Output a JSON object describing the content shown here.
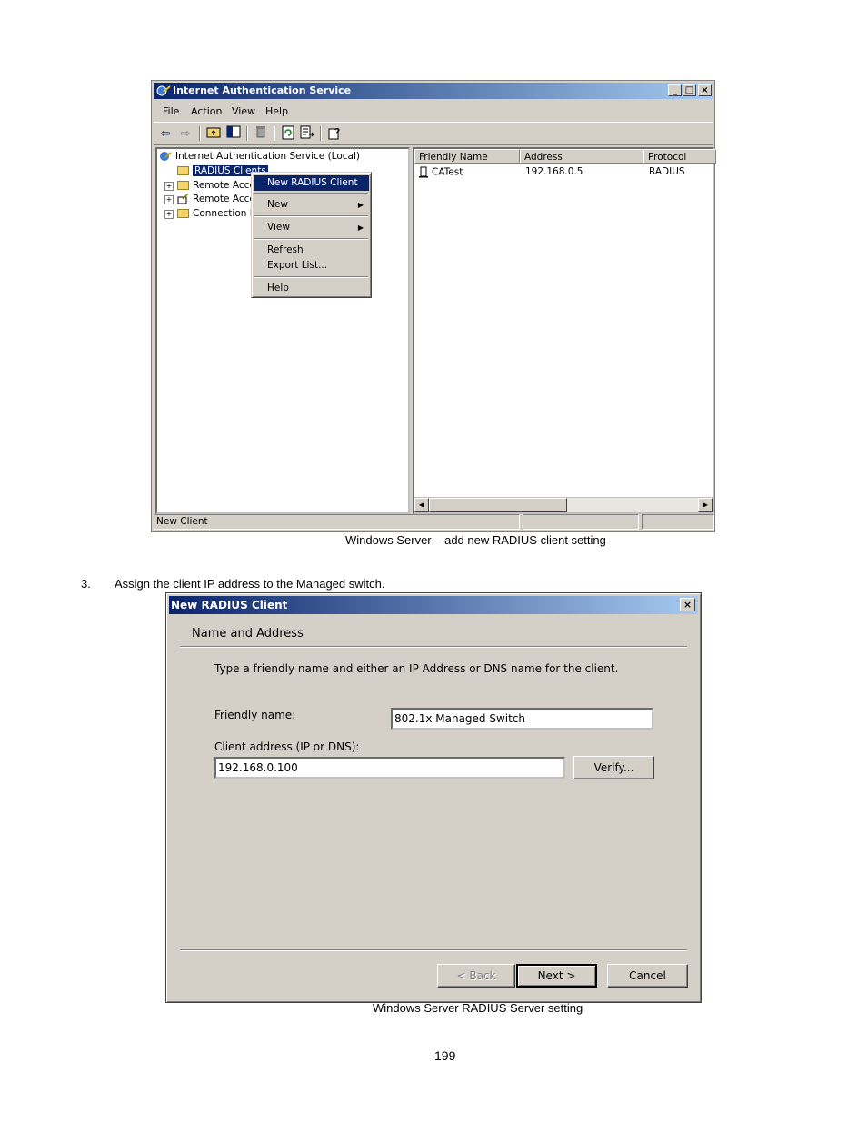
{
  "window1": {
    "title": "Internet Authentication Service",
    "caption_buttons": {
      "minimize": "_",
      "maximize": "□",
      "close": "×"
    },
    "menu": [
      "File",
      "Action",
      "View",
      "Help"
    ],
    "tree": {
      "root": "Internet Authentication Service (Local)",
      "items": [
        "RADIUS Clients",
        "Remote Acce:",
        "Remote Acce:",
        "Connection R"
      ]
    },
    "list": {
      "columns": [
        "Friendly Name",
        "Address",
        "Protocol"
      ],
      "rows": [
        {
          "name": "CATest",
          "address": "192.168.0.5",
          "protocol": "RADIUS"
        }
      ]
    },
    "status": "New Client",
    "context_menu": {
      "items": [
        "New RADIUS Client",
        "New",
        "View",
        "Refresh",
        "Export List...",
        "Help"
      ],
      "arrow": "▶"
    }
  },
  "caption1": "Windows Server – add new RADIUS client setting",
  "step": {
    "number": "3.",
    "text": "Assign the client IP address to the Managed switch."
  },
  "window2": {
    "title": "New RADIUS Client",
    "close": "×",
    "section_title": "Name and Address",
    "instruction": "Type a friendly name and either an IP Address or DNS name for the client.",
    "friendly_name_label": "Friendly name:",
    "friendly_name_value": "802.1x Managed Switch",
    "client_address_label": "Client address (IP or DNS):",
    "client_address_value": "192.168.0.100",
    "verify_button": "Verify...",
    "back_button": "< Back",
    "next_button": "Next >",
    "cancel_button": "Cancel"
  },
  "caption2": "Windows Server RADIUS Server setting",
  "page_number": "199"
}
